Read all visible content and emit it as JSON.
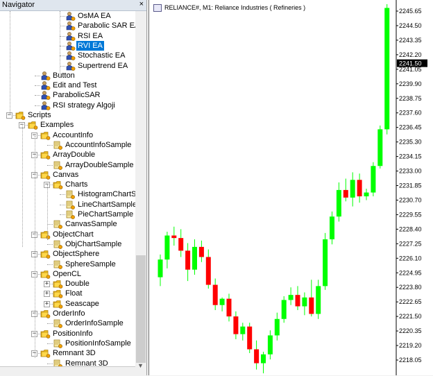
{
  "navigator": {
    "title": "Navigator",
    "close_label": "×",
    "items": [
      {
        "label": "OsMA EA",
        "depth": 4,
        "icon": "ea-icon"
      },
      {
        "label": "Parabolic SAR EA",
        "depth": 4,
        "icon": "ea-icon"
      },
      {
        "label": "RSI EA",
        "depth": 4,
        "icon": "ea-icon"
      },
      {
        "label": "RVI EA",
        "depth": 4,
        "icon": "ea-icon",
        "selected": true
      },
      {
        "label": "Stochastic EA",
        "depth": 4,
        "icon": "ea-icon"
      },
      {
        "label": "Supertrend EA",
        "depth": 4,
        "icon": "ea-icon"
      },
      {
        "label": "Button",
        "depth": 2,
        "icon": "ea-icon"
      },
      {
        "label": "Edit and Test",
        "depth": 2,
        "icon": "ea-icon"
      },
      {
        "label": "ParabolicSAR",
        "depth": 2,
        "icon": "ea-icon"
      },
      {
        "label": "RSI strategy Algoji",
        "depth": 2,
        "icon": "ea-icon"
      },
      {
        "label": "Scripts",
        "depth": 0,
        "icon": "folder-icon",
        "expander": "−"
      },
      {
        "label": "Examples",
        "depth": 1,
        "icon": "folder-icon",
        "expander": "−"
      },
      {
        "label": "AccountInfo",
        "depth": 2,
        "icon": "folder-icon",
        "expander": "−"
      },
      {
        "label": "AccountInfoSample",
        "depth": 3,
        "icon": "script-icon"
      },
      {
        "label": "ArrayDouble",
        "depth": 2,
        "icon": "folder-icon",
        "expander": "−"
      },
      {
        "label": "ArrayDoubleSample",
        "depth": 3,
        "icon": "script-icon"
      },
      {
        "label": "Canvas",
        "depth": 2,
        "icon": "folder-icon",
        "expander": "−"
      },
      {
        "label": "Charts",
        "depth": 3,
        "icon": "folder-icon",
        "expander": "−"
      },
      {
        "label": "HistogramChartSam",
        "depth": 4,
        "icon": "script-icon"
      },
      {
        "label": "LineChartSample",
        "depth": 4,
        "icon": "script-icon"
      },
      {
        "label": "PieChartSample",
        "depth": 4,
        "icon": "script-icon"
      },
      {
        "label": "CanvasSample",
        "depth": 3,
        "icon": "script-icon"
      },
      {
        "label": "ObjectChart",
        "depth": 2,
        "icon": "folder-icon",
        "expander": "−"
      },
      {
        "label": "ObjChartSample",
        "depth": 3,
        "icon": "script-icon"
      },
      {
        "label": "ObjectSphere",
        "depth": 2,
        "icon": "folder-icon",
        "expander": "−"
      },
      {
        "label": "SphereSample",
        "depth": 3,
        "icon": "script-icon"
      },
      {
        "label": "OpenCL",
        "depth": 2,
        "icon": "folder-icon",
        "expander": "−"
      },
      {
        "label": "Double",
        "depth": 3,
        "icon": "folder-icon",
        "expander": "+"
      },
      {
        "label": "Float",
        "depth": 3,
        "icon": "folder-icon",
        "expander": "+"
      },
      {
        "label": "Seascape",
        "depth": 3,
        "icon": "folder-icon",
        "expander": "+"
      },
      {
        "label": "OrderInfo",
        "depth": 2,
        "icon": "folder-icon",
        "expander": "−"
      },
      {
        "label": "OrderInfoSample",
        "depth": 3,
        "icon": "script-icon"
      },
      {
        "label": "PositionInfo",
        "depth": 2,
        "icon": "folder-icon",
        "expander": "−"
      },
      {
        "label": "PositionInfoSample",
        "depth": 3,
        "icon": "script-icon"
      },
      {
        "label": "Remnant 3D",
        "depth": 2,
        "icon": "folder-icon",
        "expander": "−"
      },
      {
        "label": "Remnant 3D",
        "depth": 3,
        "icon": "script-icon"
      }
    ]
  },
  "chart": {
    "title": "RELIANCE#, M1:  Reliance Industries ( Refineries )",
    "current_price": "2241.50",
    "colors": {
      "bull": "#00ff00",
      "bear": "#ff0000",
      "wick": "#00ff00"
    },
    "y_labels": [
      "2245.65",
      "2244.50",
      "2243.35",
      "2242.20",
      "2241.05",
      "2239.90",
      "2238.75",
      "2237.60",
      "2236.45",
      "2235.30",
      "2234.15",
      "2233.00",
      "2231.85",
      "2230.70",
      "2229.55",
      "2228.40",
      "2227.25",
      "2226.10",
      "2224.95",
      "2223.80",
      "2222.65",
      "2221.50",
      "2220.35",
      "2219.20",
      "2218.05"
    ],
    "candles": [
      {
        "o": 2224.6,
        "h": 2226.4,
        "l": 2223.9,
        "c": 2226.0
      },
      {
        "o": 2226.0,
        "h": 2228.2,
        "l": 2225.3,
        "c": 2227.9
      },
      {
        "o": 2227.9,
        "h": 2228.6,
        "l": 2227.1,
        "c": 2227.7
      },
      {
        "o": 2227.7,
        "h": 2228.4,
        "l": 2226.2,
        "c": 2226.7
      },
      {
        "o": 2226.7,
        "h": 2227.3,
        "l": 2224.3,
        "c": 2225.2
      },
      {
        "o": 2225.2,
        "h": 2227.6,
        "l": 2224.8,
        "c": 2227.0
      },
      {
        "o": 2227.0,
        "h": 2227.5,
        "l": 2225.8,
        "c": 2226.2
      },
      {
        "o": 2226.2,
        "h": 2226.8,
        "l": 2223.7,
        "c": 2224.0
      },
      {
        "o": 2224.0,
        "h": 2224.5,
        "l": 2222.0,
        "c": 2222.4
      },
      {
        "o": 2222.4,
        "h": 2223.0,
        "l": 2221.9,
        "c": 2222.9
      },
      {
        "o": 2222.9,
        "h": 2223.3,
        "l": 2221.1,
        "c": 2221.5
      },
      {
        "o": 2221.5,
        "h": 2221.9,
        "l": 2219.7,
        "c": 2220.1
      },
      {
        "o": 2220.1,
        "h": 2221.0,
        "l": 2219.6,
        "c": 2220.7
      },
      {
        "o": 2220.7,
        "h": 2221.0,
        "l": 2218.6,
        "c": 2218.9
      },
      {
        "o": 2218.9,
        "h": 2219.6,
        "l": 2217.3,
        "c": 2217.8
      },
      {
        "o": 2217.8,
        "h": 2218.7,
        "l": 2217.0,
        "c": 2218.5
      },
      {
        "o": 2218.5,
        "h": 2220.4,
        "l": 2218.1,
        "c": 2220.0
      },
      {
        "o": 2220.0,
        "h": 2221.8,
        "l": 2219.6,
        "c": 2221.3
      },
      {
        "o": 2221.3,
        "h": 2223.1,
        "l": 2221.0,
        "c": 2222.8
      },
      {
        "o": 2222.8,
        "h": 2223.8,
        "l": 2222.4,
        "c": 2223.2
      },
      {
        "o": 2223.2,
        "h": 2223.9,
        "l": 2222.0,
        "c": 2222.3
      },
      {
        "o": 2222.3,
        "h": 2223.4,
        "l": 2221.6,
        "c": 2223.0
      },
      {
        "o": 2223.0,
        "h": 2224.4,
        "l": 2221.5,
        "c": 2221.7
      },
      {
        "o": 2221.7,
        "h": 2224.4,
        "l": 2221.3,
        "c": 2223.9
      },
      {
        "o": 2223.9,
        "h": 2228.1,
        "l": 2223.6,
        "c": 2227.6
      },
      {
        "o": 2227.6,
        "h": 2229.8,
        "l": 2227.2,
        "c": 2229.4
      },
      {
        "o": 2229.4,
        "h": 2232.1,
        "l": 2229.0,
        "c": 2231.5
      },
      {
        "o": 2231.5,
        "h": 2232.4,
        "l": 2230.6,
        "c": 2230.9
      },
      {
        "o": 2230.9,
        "h": 2232.9,
        "l": 2230.2,
        "c": 2232.3
      },
      {
        "o": 2232.3,
        "h": 2232.8,
        "l": 2230.5,
        "c": 2231.0
      },
      {
        "o": 2231.0,
        "h": 2231.6,
        "l": 2230.7,
        "c": 2231.3
      },
      {
        "o": 2231.3,
        "h": 2233.7,
        "l": 2231.0,
        "c": 2233.4
      },
      {
        "o": 2233.4,
        "h": 2236.6,
        "l": 2233.2,
        "c": 2236.3
      },
      {
        "o": 2236.3,
        "h": 2246.2,
        "l": 2235.9,
        "c": 2245.9
      }
    ]
  }
}
